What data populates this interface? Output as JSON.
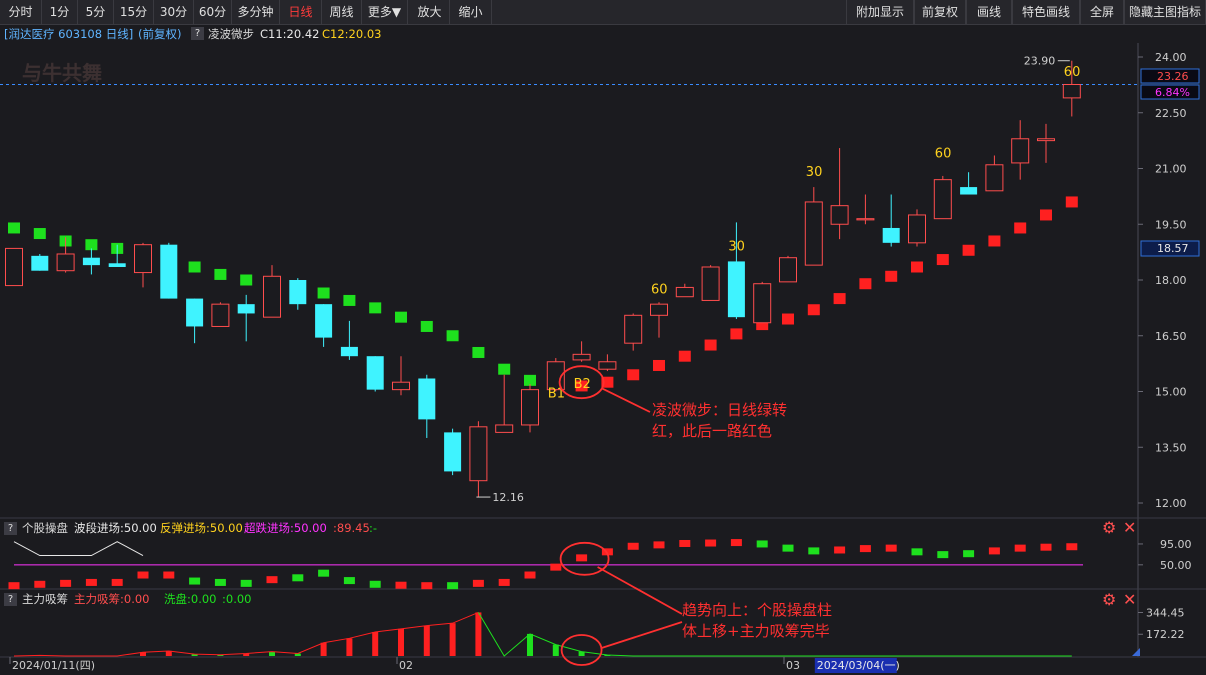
{
  "toolbar": {
    "left_buttons": [
      {
        "label": "分时",
        "active": false
      },
      {
        "label": "1分",
        "active": false
      },
      {
        "label": "5分",
        "active": false
      },
      {
        "label": "15分",
        "active": false
      },
      {
        "label": "30分",
        "active": false
      },
      {
        "label": "60分",
        "active": false
      },
      {
        "label": "多分钟",
        "active": false
      },
      {
        "label": "日线",
        "active": true
      },
      {
        "label": "周线",
        "active": false
      },
      {
        "label": "更多▼",
        "active": false
      },
      {
        "label": "放大",
        "active": false
      },
      {
        "label": "缩小",
        "active": false
      }
    ],
    "right_buttons": [
      "附加显示",
      "前复权",
      "画线",
      "特色画线",
      "全屏",
      "隐藏主图指标"
    ]
  },
  "info": {
    "stock": "[润达医疗 603108 日线]",
    "adjust": "(前复权)",
    "help": "?",
    "indicator_name": "凌波微步",
    "c1": "C11:20.42",
    "c2": "C12:20.03"
  },
  "watermark": "与牛共舞",
  "price_axis": {
    "ticks": [
      "24.00",
      "22.50",
      "21.00",
      "19.50",
      "18.00",
      "16.50",
      "15.00",
      "13.50",
      "12.00"
    ],
    "current_price": "23.26",
    "change_pct": "6.84%",
    "marker_price": "18.57"
  },
  "chart_data": {
    "type": "candlestick",
    "ylim": [
      11.5,
      24.5
    ],
    "candles": [
      {
        "o": 17.85,
        "h": 18.85,
        "l": 17.85,
        "c": 18.85
      },
      {
        "o": 18.65,
        "h": 18.7,
        "l": 18.25,
        "c": 18.25
      },
      {
        "o": 18.25,
        "h": 19.15,
        "l": 18.2,
        "c": 18.7
      },
      {
        "o": 18.6,
        "h": 18.85,
        "l": 18.15,
        "c": 18.4
      },
      {
        "o": 18.45,
        "h": 18.95,
        "l": 18.35,
        "c": 18.35
      },
      {
        "o": 18.2,
        "h": 19.0,
        "l": 17.8,
        "c": 18.95
      },
      {
        "o": 18.95,
        "h": 19.0,
        "l": 17.5,
        "c": 17.5
      },
      {
        "o": 17.5,
        "h": 17.5,
        "l": 16.3,
        "c": 16.75
      },
      {
        "o": 16.75,
        "h": 17.4,
        "l": 16.75,
        "c": 17.35
      },
      {
        "o": 17.35,
        "h": 17.6,
        "l": 16.35,
        "c": 17.1
      },
      {
        "o": 17.0,
        "h": 18.4,
        "l": 17.0,
        "c": 18.1
      },
      {
        "o": 18.0,
        "h": 18.05,
        "l": 17.2,
        "c": 17.35
      },
      {
        "o": 17.35,
        "h": 17.35,
        "l": 16.2,
        "c": 16.45
      },
      {
        "o": 16.2,
        "h": 16.9,
        "l": 15.85,
        "c": 15.95
      },
      {
        "o": 15.95,
        "h": 15.95,
        "l": 15.0,
        "c": 15.05
      },
      {
        "o": 15.05,
        "h": 15.95,
        "l": 14.9,
        "c": 15.25
      },
      {
        "o": 15.35,
        "h": 15.45,
        "l": 13.75,
        "c": 14.25
      },
      {
        "o": 13.9,
        "h": 14.0,
        "l": 12.75,
        "c": 12.85
      },
      {
        "o": 12.6,
        "h": 14.2,
        "l": 12.16,
        "c": 14.05
      },
      {
        "o": 13.9,
        "h": 15.45,
        "l": 13.9,
        "c": 14.1
      },
      {
        "o": 14.1,
        "h": 15.2,
        "l": 13.9,
        "c": 15.05
      },
      {
        "o": 15.05,
        "h": 15.9,
        "l": 15.0,
        "c": 15.8
      },
      {
        "o": 15.85,
        "h": 16.35,
        "l": 15.8,
        "c": 16.0
      },
      {
        "o": 15.6,
        "h": 16.0,
        "l": 15.55,
        "c": 15.8
      },
      {
        "o": 16.3,
        "h": 17.1,
        "l": 16.1,
        "c": 17.05
      },
      {
        "o": 17.05,
        "h": 17.4,
        "l": 16.45,
        "c": 17.35
      },
      {
        "o": 17.55,
        "h": 17.9,
        "l": 17.55,
        "c": 17.8
      },
      {
        "o": 17.45,
        "h": 18.4,
        "l": 17.45,
        "c": 18.35
      },
      {
        "o": 18.5,
        "h": 19.55,
        "l": 16.95,
        "c": 17.0
      },
      {
        "o": 16.85,
        "h": 17.95,
        "l": 16.85,
        "c": 17.9
      },
      {
        "o": 17.95,
        "h": 18.65,
        "l": 17.95,
        "c": 18.6
      },
      {
        "o": 18.4,
        "h": 20.5,
        "l": 18.4,
        "c": 20.1
      },
      {
        "o": 19.5,
        "h": 21.55,
        "l": 19.1,
        "c": 20.0
      },
      {
        "o": 19.65,
        "h": 20.3,
        "l": 19.5,
        "c": 19.65
      },
      {
        "o": 19.4,
        "h": 20.3,
        "l": 18.9,
        "c": 19.0
      },
      {
        "o": 19.0,
        "h": 19.9,
        "l": 18.9,
        "c": 19.75
      },
      {
        "o": 19.65,
        "h": 20.8,
        "l": 19.65,
        "c": 20.7
      },
      {
        "o": 20.5,
        "h": 20.9,
        "l": 20.3,
        "c": 20.3
      },
      {
        "o": 20.4,
        "h": 21.35,
        "l": 20.4,
        "c": 21.1
      },
      {
        "o": 21.15,
        "h": 22.3,
        "l": 20.7,
        "c": 21.8
      },
      {
        "o": 21.75,
        "h": 22.2,
        "l": 21.15,
        "c": 21.8
      },
      {
        "o": 22.9,
        "h": 23.9,
        "l": 22.4,
        "c": 23.26
      }
    ],
    "signal_markers": [
      {
        "i": 0,
        "v": 19.4,
        "color": "green"
      },
      {
        "i": 1,
        "v": 19.25,
        "color": "green"
      },
      {
        "i": 2,
        "v": 19.05,
        "color": "green"
      },
      {
        "i": 3,
        "v": 18.95,
        "color": "green"
      },
      {
        "i": 4,
        "v": 18.85,
        "color": "green"
      },
      {
        "i": 5,
        "v": 18.75,
        "color": "green"
      },
      {
        "i": 6,
        "v": 18.6,
        "color": "green"
      },
      {
        "i": 7,
        "v": 18.35,
        "color": "green"
      },
      {
        "i": 8,
        "v": 18.15,
        "color": "green"
      },
      {
        "i": 9,
        "v": 18.0,
        "color": "green"
      },
      {
        "i": 10,
        "v": 17.9,
        "color": "green"
      },
      {
        "i": 11,
        "v": 17.8,
        "color": "green"
      },
      {
        "i": 12,
        "v": 17.65,
        "color": "green"
      },
      {
        "i": 13,
        "v": 17.45,
        "color": "green"
      },
      {
        "i": 14,
        "v": 17.25,
        "color": "green"
      },
      {
        "i": 15,
        "v": 17.0,
        "color": "green"
      },
      {
        "i": 16,
        "v": 16.75,
        "color": "green"
      },
      {
        "i": 17,
        "v": 16.5,
        "color": "green"
      },
      {
        "i": 18,
        "v": 16.05,
        "color": "green"
      },
      {
        "i": 19,
        "v": 15.6,
        "color": "green"
      },
      {
        "i": 20,
        "v": 15.3,
        "color": "green"
      },
      {
        "i": 21,
        "v": 15.2,
        "color": "green"
      },
      {
        "i": 22,
        "v": 15.15,
        "color": "red"
      },
      {
        "i": 23,
        "v": 15.25,
        "color": "red"
      },
      {
        "i": 24,
        "v": 15.45,
        "color": "red"
      },
      {
        "i": 25,
        "v": 15.7,
        "color": "red"
      },
      {
        "i": 26,
        "v": 15.95,
        "color": "red"
      },
      {
        "i": 27,
        "v": 16.25,
        "color": "red"
      },
      {
        "i": 28,
        "v": 16.55,
        "color": "red"
      },
      {
        "i": 29,
        "v": 16.8,
        "color": "red"
      },
      {
        "i": 30,
        "v": 16.95,
        "color": "red"
      },
      {
        "i": 31,
        "v": 17.2,
        "color": "red"
      },
      {
        "i": 32,
        "v": 17.5,
        "color": "red"
      },
      {
        "i": 33,
        "v": 17.9,
        "color": "red"
      },
      {
        "i": 34,
        "v": 18.1,
        "color": "red"
      },
      {
        "i": 35,
        "v": 18.35,
        "color": "red"
      },
      {
        "i": 36,
        "v": 18.55,
        "color": "red"
      },
      {
        "i": 37,
        "v": 18.8,
        "color": "red"
      },
      {
        "i": 38,
        "v": 19.05,
        "color": "red"
      },
      {
        "i": 39,
        "v": 19.4,
        "color": "red"
      },
      {
        "i": 40,
        "v": 19.75,
        "color": "red"
      },
      {
        "i": 41,
        "v": 20.1,
        "color": "red"
      }
    ],
    "candle_labels": [
      {
        "i": 25,
        "text": "60",
        "v": 17.75
      },
      {
        "i": 28,
        "text": "30",
        "v": 18.9
      },
      {
        "i": 31,
        "text": "30",
        "v": 20.9
      },
      {
        "i": 36,
        "text": "60",
        "v": 21.4
      },
      {
        "i": 41,
        "text": "60",
        "v": 23.6
      },
      {
        "i": 21,
        "text": "B1",
        "v": 14.95
      },
      {
        "i": 22,
        "text": "B2",
        "v": 15.2
      }
    ],
    "high_label": {
      "i": 41,
      "text": "23.90",
      "v": 23.9
    },
    "low_label": {
      "i": 18,
      "text": "12.16",
      "v": 12.16
    },
    "circle_main": {
      "i": 22,
      "v": 15.25
    },
    "annotation_main": [
      "凌波微步：日线绿转",
      "红，此后一路红色"
    ],
    "sub1": {
      "title": "个股操盘",
      "label_a": "波段进场:50.00",
      "label_b": "反弹进场:50.00",
      "label_c": "超跌进场:50.00",
      "label_d": ":89.45",
      "label_e": ":-",
      "ticks": [
        "95.00",
        "50.00"
      ],
      "ylim": [
        0,
        110
      ],
      "bars": [
        {
          "v": 5,
          "color": "red"
        },
        {
          "v": 8,
          "color": "red"
        },
        {
          "v": 10,
          "color": "red"
        },
        {
          "v": 12,
          "color": "red"
        },
        {
          "v": 12,
          "color": "red"
        },
        {
          "v": 28,
          "color": "red"
        },
        {
          "v": 28,
          "color": "red"
        },
        {
          "v": 15,
          "color": "green"
        },
        {
          "v": 12,
          "color": "green"
        },
        {
          "v": 10,
          "color": "green"
        },
        {
          "v": 18,
          "color": "red"
        },
        {
          "v": 22,
          "color": "green"
        },
        {
          "v": 32,
          "color": "green"
        },
        {
          "v": 16,
          "color": "green"
        },
        {
          "v": 8,
          "color": "green"
        },
        {
          "v": 6,
          "color": "red"
        },
        {
          "v": 5,
          "color": "red"
        },
        {
          "v": 5,
          "color": "green"
        },
        {
          "v": 10,
          "color": "red"
        },
        {
          "v": 12,
          "color": "red"
        },
        {
          "v": 28,
          "color": "red"
        },
        {
          "v": 45,
          "color": "red"
        },
        {
          "v": 65,
          "color": "red"
        },
        {
          "v": 78,
          "color": "red"
        },
        {
          "v": 90,
          "color": "red"
        },
        {
          "v": 93,
          "color": "red"
        },
        {
          "v": 96,
          "color": "red"
        },
        {
          "v": 97,
          "color": "red"
        },
        {
          "v": 98,
          "color": "red"
        },
        {
          "v": 95,
          "color": "green"
        },
        {
          "v": 86,
          "color": "green"
        },
        {
          "v": 80,
          "color": "green"
        },
        {
          "v": 82,
          "color": "red"
        },
        {
          "v": 85,
          "color": "red"
        },
        {
          "v": 86,
          "color": "red"
        },
        {
          "v": 78,
          "color": "green"
        },
        {
          "v": 72,
          "color": "green"
        },
        {
          "v": 74,
          "color": "green"
        },
        {
          "v": 80,
          "color": "red"
        },
        {
          "v": 86,
          "color": "red"
        },
        {
          "v": 88,
          "color": "red"
        },
        {
          "v": 89,
          "color": "red"
        }
      ],
      "white_line": [
        {
          "i": 0,
          "v": 100
        },
        {
          "i": 1,
          "v": 70
        },
        {
          "i": 2,
          "v": 70
        },
        {
          "i": 3,
          "v": 70
        },
        {
          "i": 4,
          "v": 100
        },
        {
          "i": 5,
          "v": 70
        }
      ],
      "magenta_level": 50
    },
    "sub2": {
      "title": "主力吸筹",
      "label_a": "主力吸筹:0.00",
      "label_b": "洗盘:0.00",
      "label_c": ":0.00",
      "ticks": [
        "344.45",
        "172.22"
      ],
      "ylim": [
        0,
        380
      ],
      "bars": [
        {
          "v": 0,
          "color": "red"
        },
        {
          "v": 5,
          "color": "red"
        },
        {
          "v": 0,
          "color": "red"
        },
        {
          "v": 0,
          "color": "red"
        },
        {
          "v": 0,
          "color": "red"
        },
        {
          "v": 30,
          "color": "red"
        },
        {
          "v": 40,
          "color": "red"
        },
        {
          "v": 15,
          "color": "green"
        },
        {
          "v": 10,
          "color": "green"
        },
        {
          "v": 20,
          "color": "red"
        },
        {
          "v": 35,
          "color": "green"
        },
        {
          "v": 20,
          "color": "green"
        },
        {
          "v": 105,
          "color": "red"
        },
        {
          "v": 140,
          "color": "red"
        },
        {
          "v": 190,
          "color": "red"
        },
        {
          "v": 215,
          "color": "red"
        },
        {
          "v": 240,
          "color": "red"
        },
        {
          "v": 260,
          "color": "red"
        },
        {
          "v": 345,
          "color": "red"
        },
        {
          "v": 0,
          "color": "red"
        },
        {
          "v": 175,
          "color": "green"
        },
        {
          "v": 90,
          "color": "green"
        },
        {
          "v": 35,
          "color": "green"
        },
        {
          "v": 8,
          "color": "green"
        },
        {
          "v": 0,
          "color": "green"
        },
        {
          "v": 0,
          "color": "green"
        },
        {
          "v": 0,
          "color": "green"
        },
        {
          "v": 0,
          "color": "green"
        },
        {
          "v": 0,
          "color": "green"
        },
        {
          "v": 0,
          "color": "green"
        },
        {
          "v": 0,
          "color": "green"
        },
        {
          "v": 0,
          "color": "green"
        },
        {
          "v": 0,
          "color": "green"
        },
        {
          "v": 0,
          "color": "green"
        },
        {
          "v": 0,
          "color": "green"
        },
        {
          "v": 0,
          "color": "green"
        },
        {
          "v": 0,
          "color": "green"
        },
        {
          "v": 0,
          "color": "green"
        },
        {
          "v": 0,
          "color": "green"
        },
        {
          "v": 0,
          "color": "green"
        },
        {
          "v": 0,
          "color": "green"
        },
        {
          "v": 0,
          "color": "green"
        }
      ]
    },
    "annotation_sub": [
      "趋势向上：个股操盘柱",
      "体上移+主力吸筹完毕"
    ],
    "circle_sub1": {
      "i": 22,
      "v": 50
    },
    "circle_sub2": {
      "i": 22,
      "v": 0
    },
    "date_labels": [
      {
        "i": 0,
        "text": "2024/01/11(四)"
      },
      {
        "i": 15,
        "text": "02"
      },
      {
        "i": 30,
        "text": "03"
      }
    ],
    "highlight_date": {
      "i": 31,
      "text": "2024/03/04(一)"
    }
  },
  "colors": {
    "up": "#ff4d4d",
    "down": "#3ff3ff",
    "green_marker": "#1ee01e",
    "red_marker": "#ff2020",
    "label_yellow": "#ffd21e",
    "annotation": "#ff3030",
    "magenta": "#ff33ff",
    "tick": "#cfcfcf"
  }
}
